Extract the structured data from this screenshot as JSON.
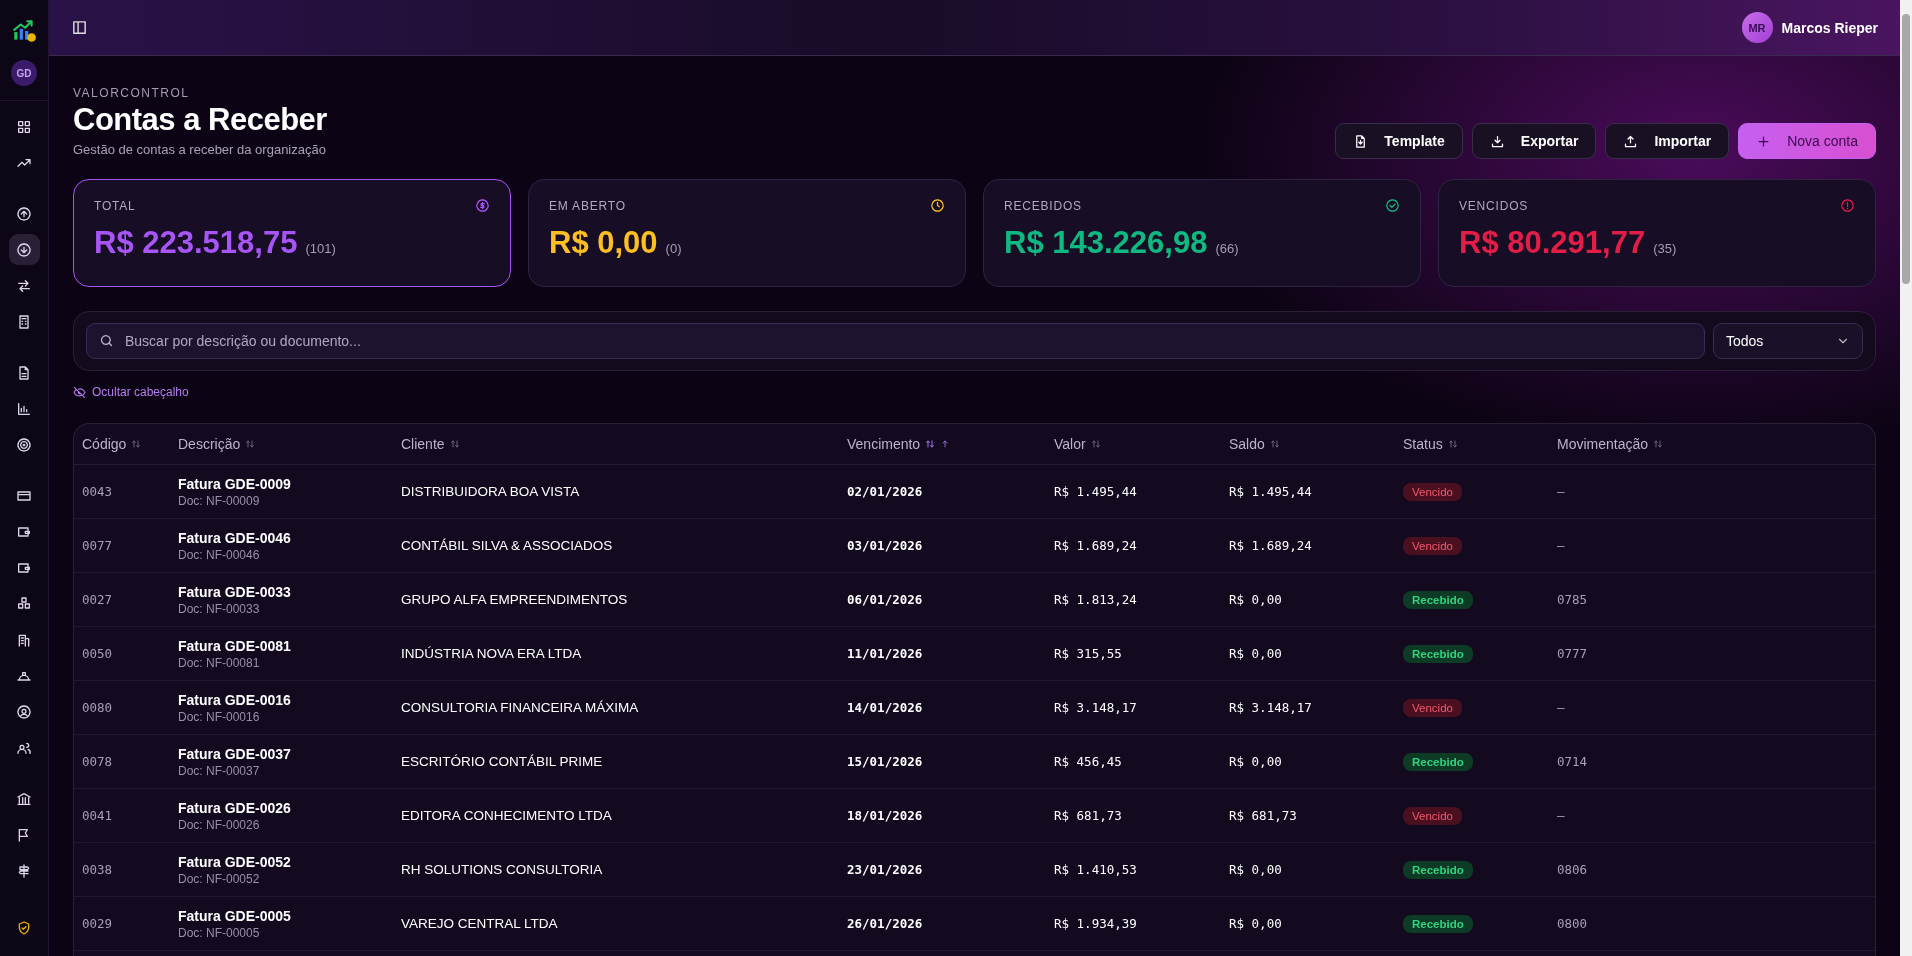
{
  "sidebar": {
    "org_avatar": "GD",
    "groups": [
      {
        "items": [
          {
            "selected": false
          },
          {
            "selected": false
          }
        ]
      },
      {
        "items": [
          {
            "selected": false
          },
          {
            "selected": true
          },
          {
            "selected": false
          },
          {
            "selected": false
          }
        ]
      },
      {
        "items": [
          {
            "selected": false
          },
          {
            "selected": false
          },
          {
            "selected": false
          }
        ]
      },
      {
        "items": [
          {
            "selected": false
          },
          {
            "selected": false
          },
          {
            "selected": false
          },
          {
            "selected": false
          },
          {
            "selected": false
          },
          {
            "selected": false
          },
          {
            "selected": false
          },
          {
            "selected": false
          }
        ]
      },
      {
        "items": [
          {
            "selected": false
          },
          {
            "selected": false
          },
          {
            "selected": false
          }
        ]
      }
    ]
  },
  "topbar": {
    "user": {
      "initials": "MR",
      "name": "Marcos Rieper"
    }
  },
  "page": {
    "eyebrow": "VALORCONTROL",
    "title": "Contas a Receber",
    "subtitle": "Gestão de contas a receber da organização",
    "actions": [
      {
        "label": "Template",
        "kind": "template"
      },
      {
        "label": "Exportar",
        "kind": "export"
      },
      {
        "label": "Importar",
        "kind": "import"
      },
      {
        "label": "Nova conta",
        "kind": "primary"
      }
    ]
  },
  "cards": [
    {
      "label": "TOTAL",
      "value": "R$ 223.518,75",
      "count": "(101)",
      "color": "#a855f7",
      "kind": "dollar",
      "selected": true
    },
    {
      "label": "EM ABERTO",
      "value": "R$ 0,00",
      "count": "(0)",
      "color": "#fbbf24",
      "kind": "clock",
      "selected": false
    },
    {
      "label": "RECEBIDOS",
      "value": "R$ 143.226,98",
      "count": "(66)",
      "color": "#10b981",
      "kind": "check",
      "selected": false
    },
    {
      "label": "VENCIDOS",
      "value": "R$ 80.291,77",
      "count": "(35)",
      "color": "#e11d48",
      "kind": "alert",
      "selected": false
    }
  ],
  "filters": {
    "search": {
      "placeholder": "Buscar por descrição ou documento..."
    },
    "status_select": {
      "value": "Todos"
    },
    "toggle_header": "Ocultar cabeçalho"
  },
  "table": {
    "columns": [
      {
        "label": "Código",
        "sorted": false
      },
      {
        "label": "Descrição",
        "sorted": false
      },
      {
        "label": "Cliente",
        "sorted": false
      },
      {
        "label": "Vencimento",
        "sorted": true
      },
      {
        "label": "Valor",
        "sorted": false
      },
      {
        "label": "Saldo",
        "sorted": false
      },
      {
        "label": "Status",
        "sorted": false
      },
      {
        "label": "Movimentação",
        "sorted": false
      }
    ],
    "rows": [
      {
        "code": "0043",
        "description": "Fatura GDE-0009",
        "doc": "Doc: NF-00009",
        "client": "DISTRIBUIDORA BOA VISTA",
        "due": "02/01/2026",
        "value": "R$ 1.495,44",
        "balance": "R$ 1.495,44",
        "status": {
          "label": "Vencido",
          "kind": "overdue"
        },
        "movement": "—"
      },
      {
        "code": "0077",
        "description": "Fatura GDE-0046",
        "doc": "Doc: NF-00046",
        "client": "CONTÁBIL SILVA & ASSOCIADOS",
        "due": "03/01/2026",
        "value": "R$ 1.689,24",
        "balance": "R$ 1.689,24",
        "status": {
          "label": "Vencido",
          "kind": "overdue"
        },
        "movement": "—"
      },
      {
        "code": "0027",
        "description": "Fatura GDE-0033",
        "doc": "Doc: NF-00033",
        "client": "GRUPO ALFA EMPREENDIMENTOS",
        "due": "06/01/2026",
        "value": "R$ 1.813,24",
        "balance": "R$ 0,00",
        "status": {
          "label": "Recebido",
          "kind": "received"
        },
        "movement": "0785"
      },
      {
        "code": "0050",
        "description": "Fatura GDE-0081",
        "doc": "Doc: NF-00081",
        "client": "INDÚSTRIA NOVA ERA LTDA",
        "due": "11/01/2026",
        "value": "R$ 315,55",
        "balance": "R$ 0,00",
        "status": {
          "label": "Recebido",
          "kind": "received"
        },
        "movement": "0777"
      },
      {
        "code": "0080",
        "description": "Fatura GDE-0016",
        "doc": "Doc: NF-00016",
        "client": "CONSULTORIA FINANCEIRA MÁXIMA",
        "due": "14/01/2026",
        "value": "R$ 3.148,17",
        "balance": "R$ 3.148,17",
        "status": {
          "label": "Vencido",
          "kind": "overdue"
        },
        "movement": "—"
      },
      {
        "code": "0078",
        "description": "Fatura GDE-0037",
        "doc": "Doc: NF-00037",
        "client": "ESCRITÓRIO CONTÁBIL PRIME",
        "due": "15/01/2026",
        "value": "R$ 456,45",
        "balance": "R$ 0,00",
        "status": {
          "label": "Recebido",
          "kind": "received"
        },
        "movement": "0714"
      },
      {
        "code": "0041",
        "description": "Fatura GDE-0026",
        "doc": "Doc: NF-00026",
        "client": "EDITORA CONHECIMENTO LTDA",
        "due": "18/01/2026",
        "value": "R$ 681,73",
        "balance": "R$ 681,73",
        "status": {
          "label": "Vencido",
          "kind": "overdue"
        },
        "movement": "—"
      },
      {
        "code": "0038",
        "description": "Fatura GDE-0052",
        "doc": "Doc: NF-00052",
        "client": "RH SOLUTIONS CONSULTORIA",
        "due": "23/01/2026",
        "value": "R$ 1.410,53",
        "balance": "R$ 0,00",
        "status": {
          "label": "Recebido",
          "kind": "received"
        },
        "movement": "0806"
      },
      {
        "code": "0029",
        "description": "Fatura GDE-0005",
        "doc": "Doc: NF-00005",
        "client": "VAREJO CENTRAL LTDA",
        "due": "26/01/2026",
        "value": "R$ 1.934,39",
        "balance": "R$ 0,00",
        "status": {
          "label": "Recebido",
          "kind": "received"
        },
        "movement": "0800"
      }
    ]
  }
}
